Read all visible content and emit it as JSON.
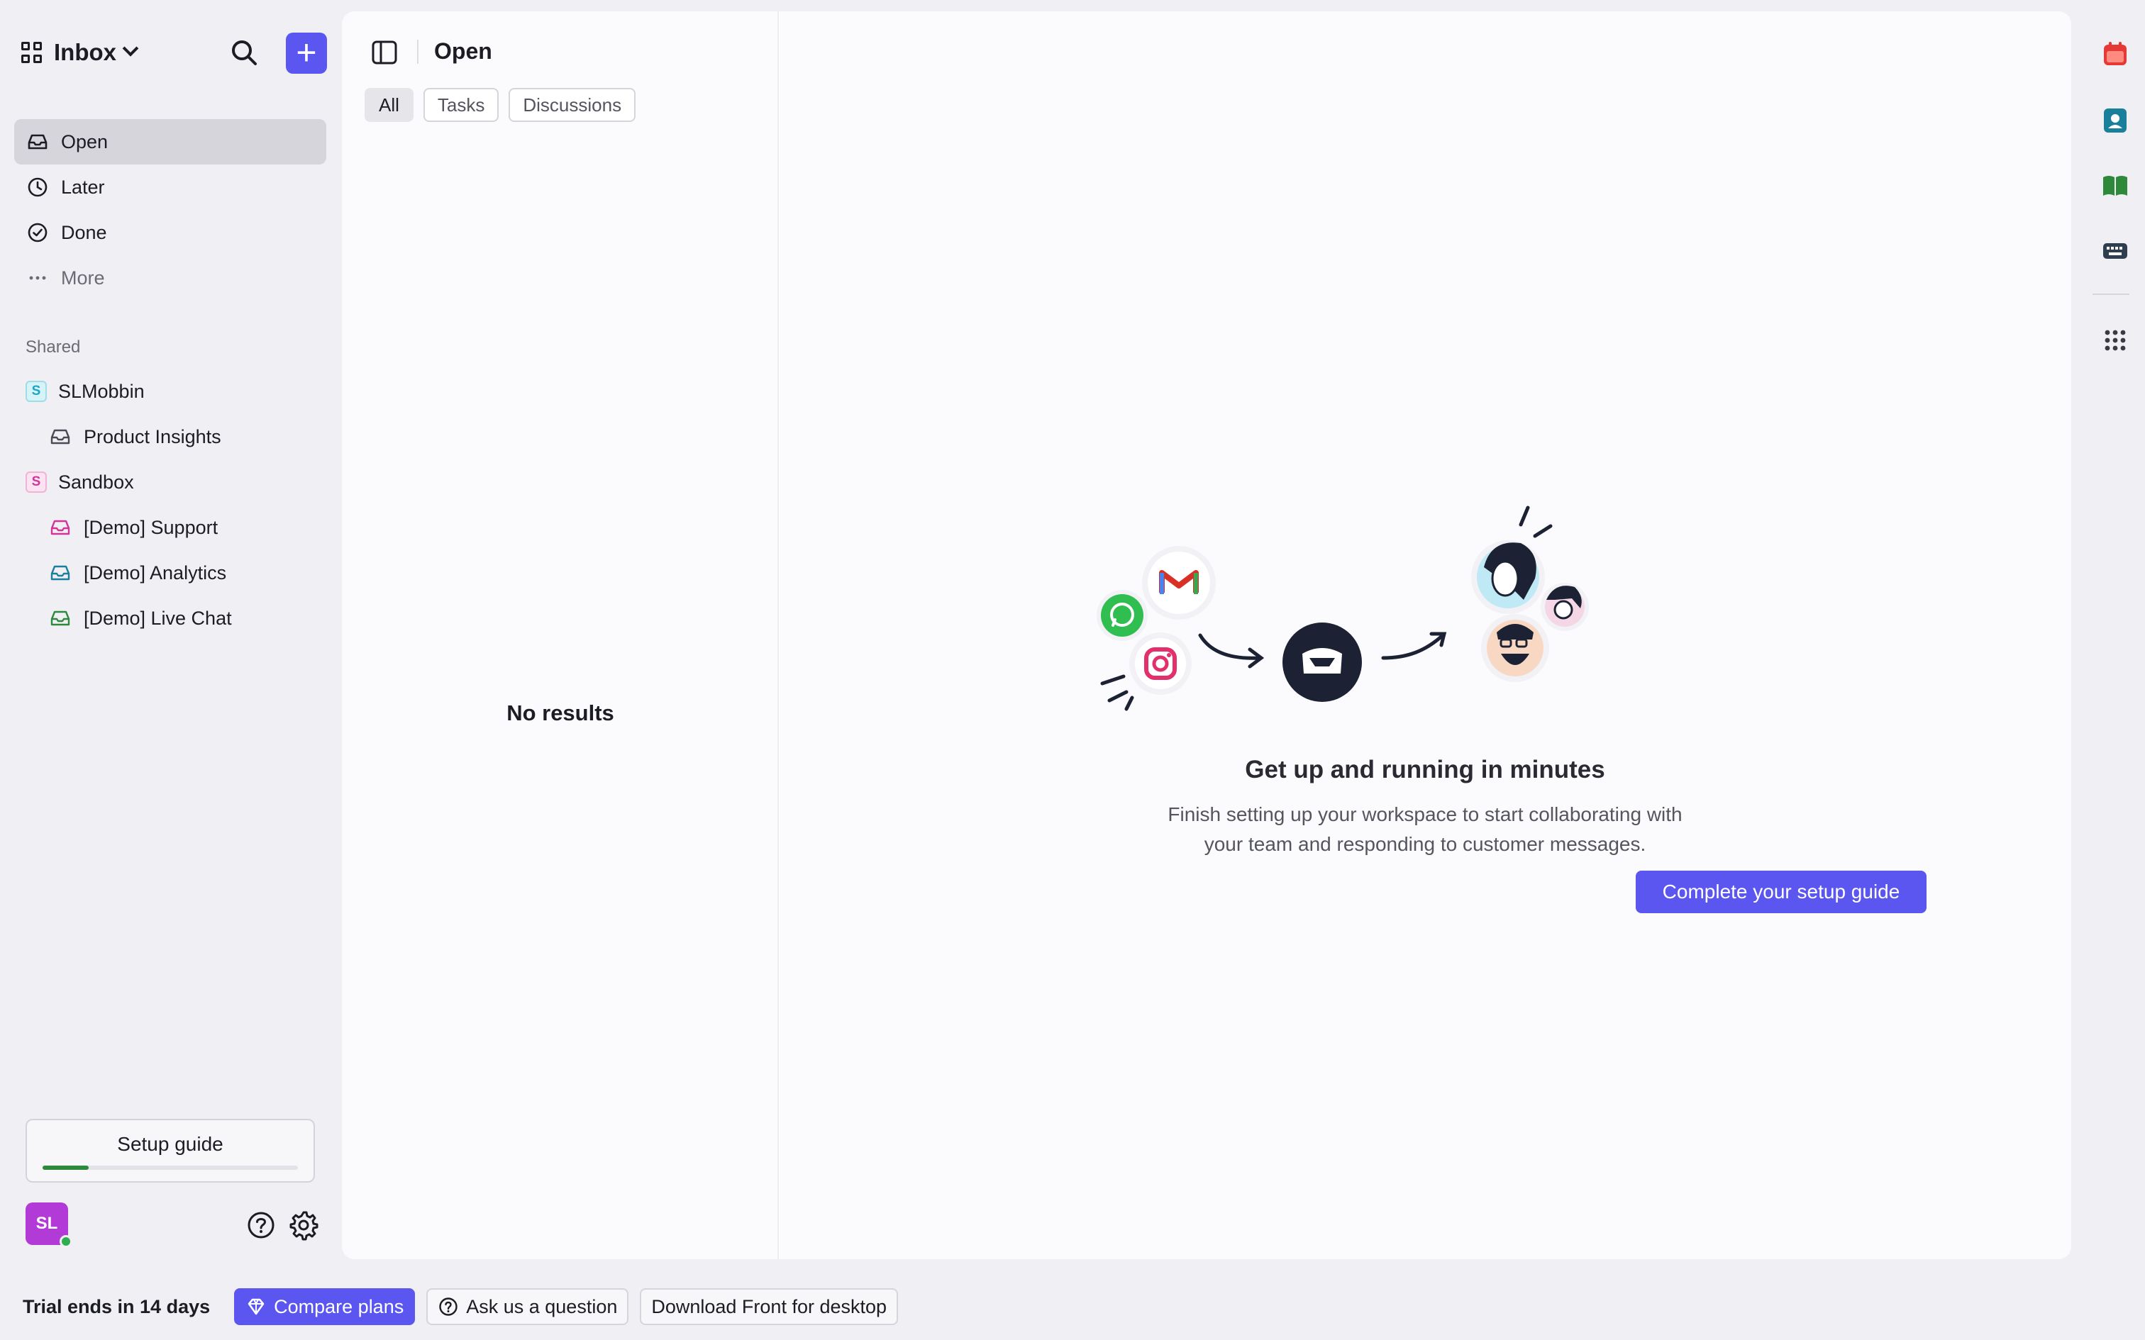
{
  "sidebar": {
    "title": "Inbox",
    "nav": [
      {
        "label": "Open",
        "icon": "inbox-icon"
      },
      {
        "label": "Later",
        "icon": "clock-icon"
      },
      {
        "label": "Done",
        "icon": "check-circle-icon"
      },
      {
        "label": "More",
        "icon": "more-icon"
      }
    ],
    "shared_label": "Shared",
    "tree": [
      {
        "label": "SLMobbin",
        "badge": "S",
        "badge_color": "#1aa6c7"
      },
      {
        "label": "Product Insights"
      },
      {
        "label": "Sandbox",
        "badge": "S",
        "badge_color": "#d1359a"
      },
      {
        "label": "[Demo] Support",
        "color": "#d1359a"
      },
      {
        "label": "[Demo] Analytics",
        "color": "#1a7f9a"
      },
      {
        "label": "[Demo] Live Chat",
        "color": "#2e8a3a"
      }
    ],
    "setup_guide": {
      "label": "Setup guide",
      "progress": 0.18
    },
    "avatar_initials": "SL"
  },
  "list": {
    "title": "Open",
    "tabs": [
      "All",
      "Tasks",
      "Discussions"
    ],
    "empty_text": "No results"
  },
  "detail": {
    "title": "Get up and running in minutes",
    "subtitle_line1": "Finish setting up your workspace to start collaborating with",
    "subtitle_line2": "your team and responding to customer messages.",
    "cta": "Complete your setup guide"
  },
  "bottom": {
    "trial": "Trial ends in 14 days",
    "compare": "Compare plans",
    "ask": "Ask us a question",
    "download": "Download Front for desktop"
  },
  "colors": {
    "accent": "#5b56f0",
    "sidebar_bg": "#f0eff4",
    "active_item": "#d6d5dc",
    "avatar": "#b23ad6",
    "online": "#2fae4f",
    "progress": "#2e8a3a"
  }
}
